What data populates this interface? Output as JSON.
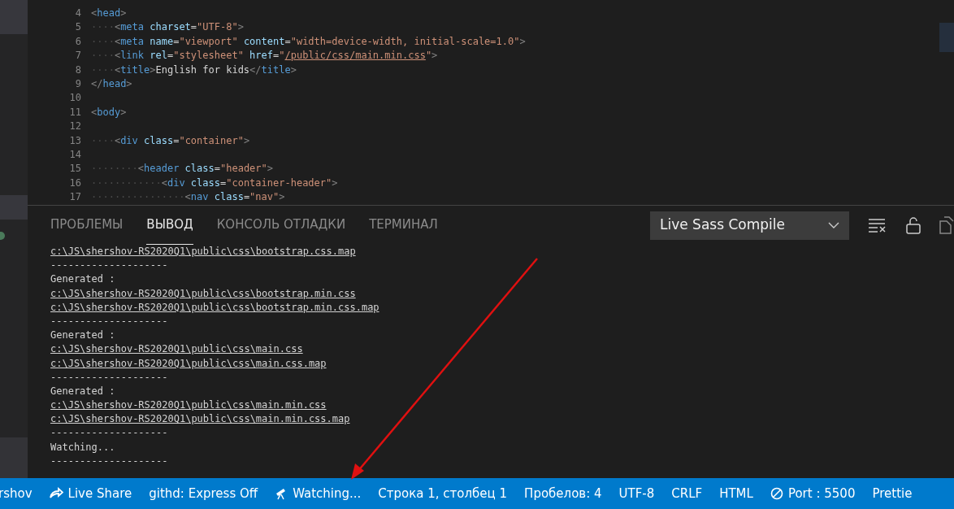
{
  "editor": {
    "lines": [
      {
        "number": "4",
        "segments": [
          {
            "kind": "punct",
            "text": "<"
          },
          {
            "kind": "tag",
            "text": "head"
          },
          {
            "kind": "punct",
            "text": ">"
          }
        ]
      },
      {
        "number": "5",
        "segments": [
          {
            "kind": "ws",
            "text": "····"
          },
          {
            "kind": "punct",
            "text": "<"
          },
          {
            "kind": "tag",
            "text": "meta"
          },
          {
            "kind": "attr",
            "text": " charset"
          },
          {
            "kind": "text",
            "text": "="
          },
          {
            "kind": "str",
            "text": "\"UTF-8\""
          },
          {
            "kind": "punct",
            "text": ">"
          }
        ]
      },
      {
        "number": "6",
        "segments": [
          {
            "kind": "ws",
            "text": "····"
          },
          {
            "kind": "punct",
            "text": "<"
          },
          {
            "kind": "tag",
            "text": "meta"
          },
          {
            "kind": "attr",
            "text": " name"
          },
          {
            "kind": "text",
            "text": "="
          },
          {
            "kind": "str",
            "text": "\"viewport\""
          },
          {
            "kind": "attr",
            "text": " content"
          },
          {
            "kind": "text",
            "text": "="
          },
          {
            "kind": "str",
            "text": "\"width=device-width, initial-scale=1.0\""
          },
          {
            "kind": "punct",
            "text": ">"
          }
        ]
      },
      {
        "number": "7",
        "segments": [
          {
            "kind": "ws",
            "text": "····"
          },
          {
            "kind": "punct",
            "text": "<"
          },
          {
            "kind": "tag",
            "text": "link"
          },
          {
            "kind": "attr",
            "text": " rel"
          },
          {
            "kind": "text",
            "text": "="
          },
          {
            "kind": "str",
            "text": "\"stylesheet\""
          },
          {
            "kind": "attr",
            "text": " href"
          },
          {
            "kind": "text",
            "text": "="
          },
          {
            "kind": "str",
            "text": "\""
          },
          {
            "kind": "link",
            "text": "/public/css/main.min.css"
          },
          {
            "kind": "str",
            "text": "\""
          },
          {
            "kind": "punct",
            "text": ">"
          }
        ]
      },
      {
        "number": "8",
        "segments": [
          {
            "kind": "ws",
            "text": "····"
          },
          {
            "kind": "punct",
            "text": "<"
          },
          {
            "kind": "tag",
            "text": "title"
          },
          {
            "kind": "punct",
            "text": ">"
          },
          {
            "kind": "text",
            "text": "English for kids"
          },
          {
            "kind": "punct",
            "text": "</"
          },
          {
            "kind": "tag",
            "text": "title"
          },
          {
            "kind": "punct",
            "text": ">"
          }
        ]
      },
      {
        "number": "9",
        "segments": [
          {
            "kind": "punct",
            "text": "</"
          },
          {
            "kind": "tag",
            "text": "head"
          },
          {
            "kind": "punct",
            "text": ">"
          }
        ]
      },
      {
        "number": "10"
      },
      {
        "number": "11",
        "segments": [
          {
            "kind": "punct",
            "text": "<"
          },
          {
            "kind": "tag",
            "text": "body"
          },
          {
            "kind": "punct",
            "text": ">"
          }
        ]
      },
      {
        "number": "12"
      },
      {
        "number": "13",
        "segments": [
          {
            "kind": "ws",
            "text": "····"
          },
          {
            "kind": "punct",
            "text": "<"
          },
          {
            "kind": "tag",
            "text": "div"
          },
          {
            "kind": "attr",
            "text": " class"
          },
          {
            "kind": "text",
            "text": "="
          },
          {
            "kind": "str",
            "text": "\"container\""
          },
          {
            "kind": "punct",
            "text": ">"
          }
        ]
      },
      {
        "number": "14"
      },
      {
        "number": "15",
        "segments": [
          {
            "kind": "ws",
            "text": "········"
          },
          {
            "kind": "punct",
            "text": "<"
          },
          {
            "kind": "tag",
            "text": "header"
          },
          {
            "kind": "attr",
            "text": " class"
          },
          {
            "kind": "text",
            "text": "="
          },
          {
            "kind": "str",
            "text": "\"header\""
          },
          {
            "kind": "punct",
            "text": ">"
          }
        ]
      },
      {
        "number": "16",
        "segments": [
          {
            "kind": "ws",
            "text": "············"
          },
          {
            "kind": "punct",
            "text": "<"
          },
          {
            "kind": "tag",
            "text": "div"
          },
          {
            "kind": "attr",
            "text": " class"
          },
          {
            "kind": "text",
            "text": "="
          },
          {
            "kind": "str",
            "text": "\"container-header\""
          },
          {
            "kind": "punct",
            "text": ">"
          }
        ]
      },
      {
        "number": "17",
        "segments": [
          {
            "kind": "ws",
            "text": "················"
          },
          {
            "kind": "punct",
            "text": "<"
          },
          {
            "kind": "tag",
            "text": "nav"
          },
          {
            "kind": "attr",
            "text": " class"
          },
          {
            "kind": "text",
            "text": "="
          },
          {
            "kind": "str",
            "text": "\"nav\""
          },
          {
            "kind": "punct",
            "text": ">"
          }
        ]
      }
    ]
  },
  "panel": {
    "tabs": [
      {
        "label": "ПРОБЛЕМЫ",
        "selected": false
      },
      {
        "label": "ВЫВОД",
        "selected": true
      },
      {
        "label": "КОНСОЛЬ ОТЛАДКИ",
        "selected": false
      },
      {
        "label": "ТЕРМИНАЛ",
        "selected": false
      }
    ],
    "output_channel": "Live Sass Compile",
    "output": [
      {
        "kind": "link",
        "text": "c:\\JS\\shershov-RS2020Q1\\public\\css\\bootstrap.css.map"
      },
      {
        "kind": "text",
        "text": "--------------------"
      },
      {
        "kind": "text",
        "text": "Generated :"
      },
      {
        "kind": "link",
        "text": "c:\\JS\\shershov-RS2020Q1\\public\\css\\bootstrap.min.css"
      },
      {
        "kind": "link",
        "text": "c:\\JS\\shershov-RS2020Q1\\public\\css\\bootstrap.min.css.map"
      },
      {
        "kind": "text",
        "text": "--------------------"
      },
      {
        "kind": "text",
        "text": "Generated :"
      },
      {
        "kind": "link",
        "text": "c:\\JS\\shershov-RS2020Q1\\public\\css\\main.css"
      },
      {
        "kind": "link",
        "text": "c:\\JS\\shershov-RS2020Q1\\public\\css\\main.css.map"
      },
      {
        "kind": "text",
        "text": "--------------------"
      },
      {
        "kind": "text",
        "text": "Generated :"
      },
      {
        "kind": "link",
        "text": "c:\\JS\\shershov-RS2020Q1\\public\\css\\main.min.css"
      },
      {
        "kind": "link",
        "text": "c:\\JS\\shershov-RS2020Q1\\public\\css\\main.min.css.map"
      },
      {
        "kind": "text",
        "text": "--------------------"
      },
      {
        "kind": "text",
        "text": "Watching..."
      },
      {
        "kind": "text",
        "text": "--------------------"
      }
    ]
  },
  "status_bar": [
    {
      "kind": "plain",
      "text": "rshov"
    },
    {
      "kind": "live-share",
      "text": "Live Share"
    },
    {
      "kind": "plain",
      "text": "githd: Express Off"
    },
    {
      "kind": "watching",
      "text": "Watching..."
    },
    {
      "kind": "plain",
      "text": "Строка 1, столбец 1"
    },
    {
      "kind": "plain",
      "text": "Пробелов: 4"
    },
    {
      "kind": "plain",
      "text": "UTF-8"
    },
    {
      "kind": "plain",
      "text": "CRLF"
    },
    {
      "kind": "plain",
      "text": "HTML"
    },
    {
      "kind": "port",
      "text": "Port : 5500"
    },
    {
      "kind": "plain",
      "text": "Prettie"
    }
  ]
}
